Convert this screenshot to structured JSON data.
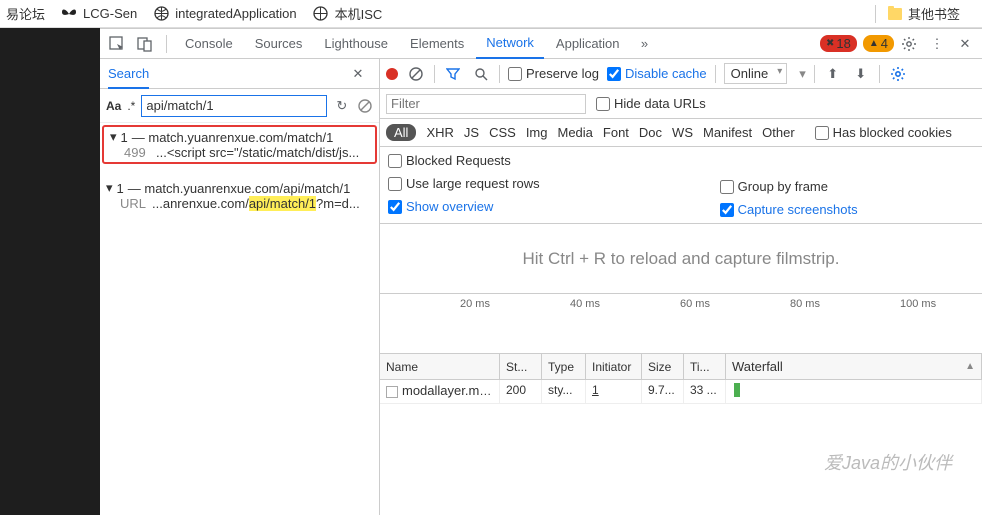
{
  "bookmarks": {
    "b1": "易论坛",
    "b2": "LCG-Sen",
    "b3": "integratedApplication",
    "b4": "本机ISC",
    "other": "其他书签"
  },
  "tabs": {
    "console": "Console",
    "sources": "Sources",
    "lighthouse": "Lighthouse",
    "elements": "Elements",
    "network": "Network",
    "application": "Application"
  },
  "badges": {
    "errors": "18",
    "warnings": "4"
  },
  "search": {
    "title": "Search",
    "aa": "Aa",
    "regex": ".*",
    "value": "api/match/1",
    "g1_count": "1",
    "g1_host": "— match.yuanrenxue.com/match/1",
    "g1_ln": "499",
    "g1_txt": "...<script src=\"/static/match/dist/js...",
    "g2_count": "1",
    "g2_host": "— match.yuanrenxue.com/api/match/1",
    "g2_ln": "URL",
    "g2_pre": "...anrenxue.com/",
    "g2_hl": "api/match/1",
    "g2_post": "?m=d..."
  },
  "toolbar": {
    "preserve": "Preserve log",
    "disable": "Disable cache",
    "online": "Online"
  },
  "filter": {
    "placeholder": "Filter",
    "hide": "Hide data URLs"
  },
  "types": {
    "all": "All",
    "xhr": "XHR",
    "js": "JS",
    "css": "CSS",
    "img": "Img",
    "media": "Media",
    "font": "Font",
    "doc": "Doc",
    "ws": "WS",
    "manifest": "Manifest",
    "other": "Other",
    "blocked": "Has blocked cookies"
  },
  "opts": {
    "blockedreq": "Blocked Requests",
    "large": "Use large request rows",
    "group": "Group by frame",
    "overview": "Show overview",
    "capture": "Capture screenshots"
  },
  "film": "Hit Ctrl + R to reload and capture filmstrip.",
  "timeline": {
    "t1": "20 ms",
    "t2": "40 ms",
    "t3": "60 ms",
    "t4": "80 ms",
    "t5": "100 ms"
  },
  "table": {
    "h1": "Name",
    "h2": "St...",
    "h3": "Type",
    "h4": "Initiator",
    "h5": "Size",
    "h6": "Ti...",
    "h7": "Waterfall",
    "r1": {
      "name": "modallayer.mi...",
      "status": "200",
      "type": "sty...",
      "initiator": "1",
      "size": "9.7...",
      "time": "33 ..."
    }
  },
  "watermark": "爱Java的小伙伴"
}
